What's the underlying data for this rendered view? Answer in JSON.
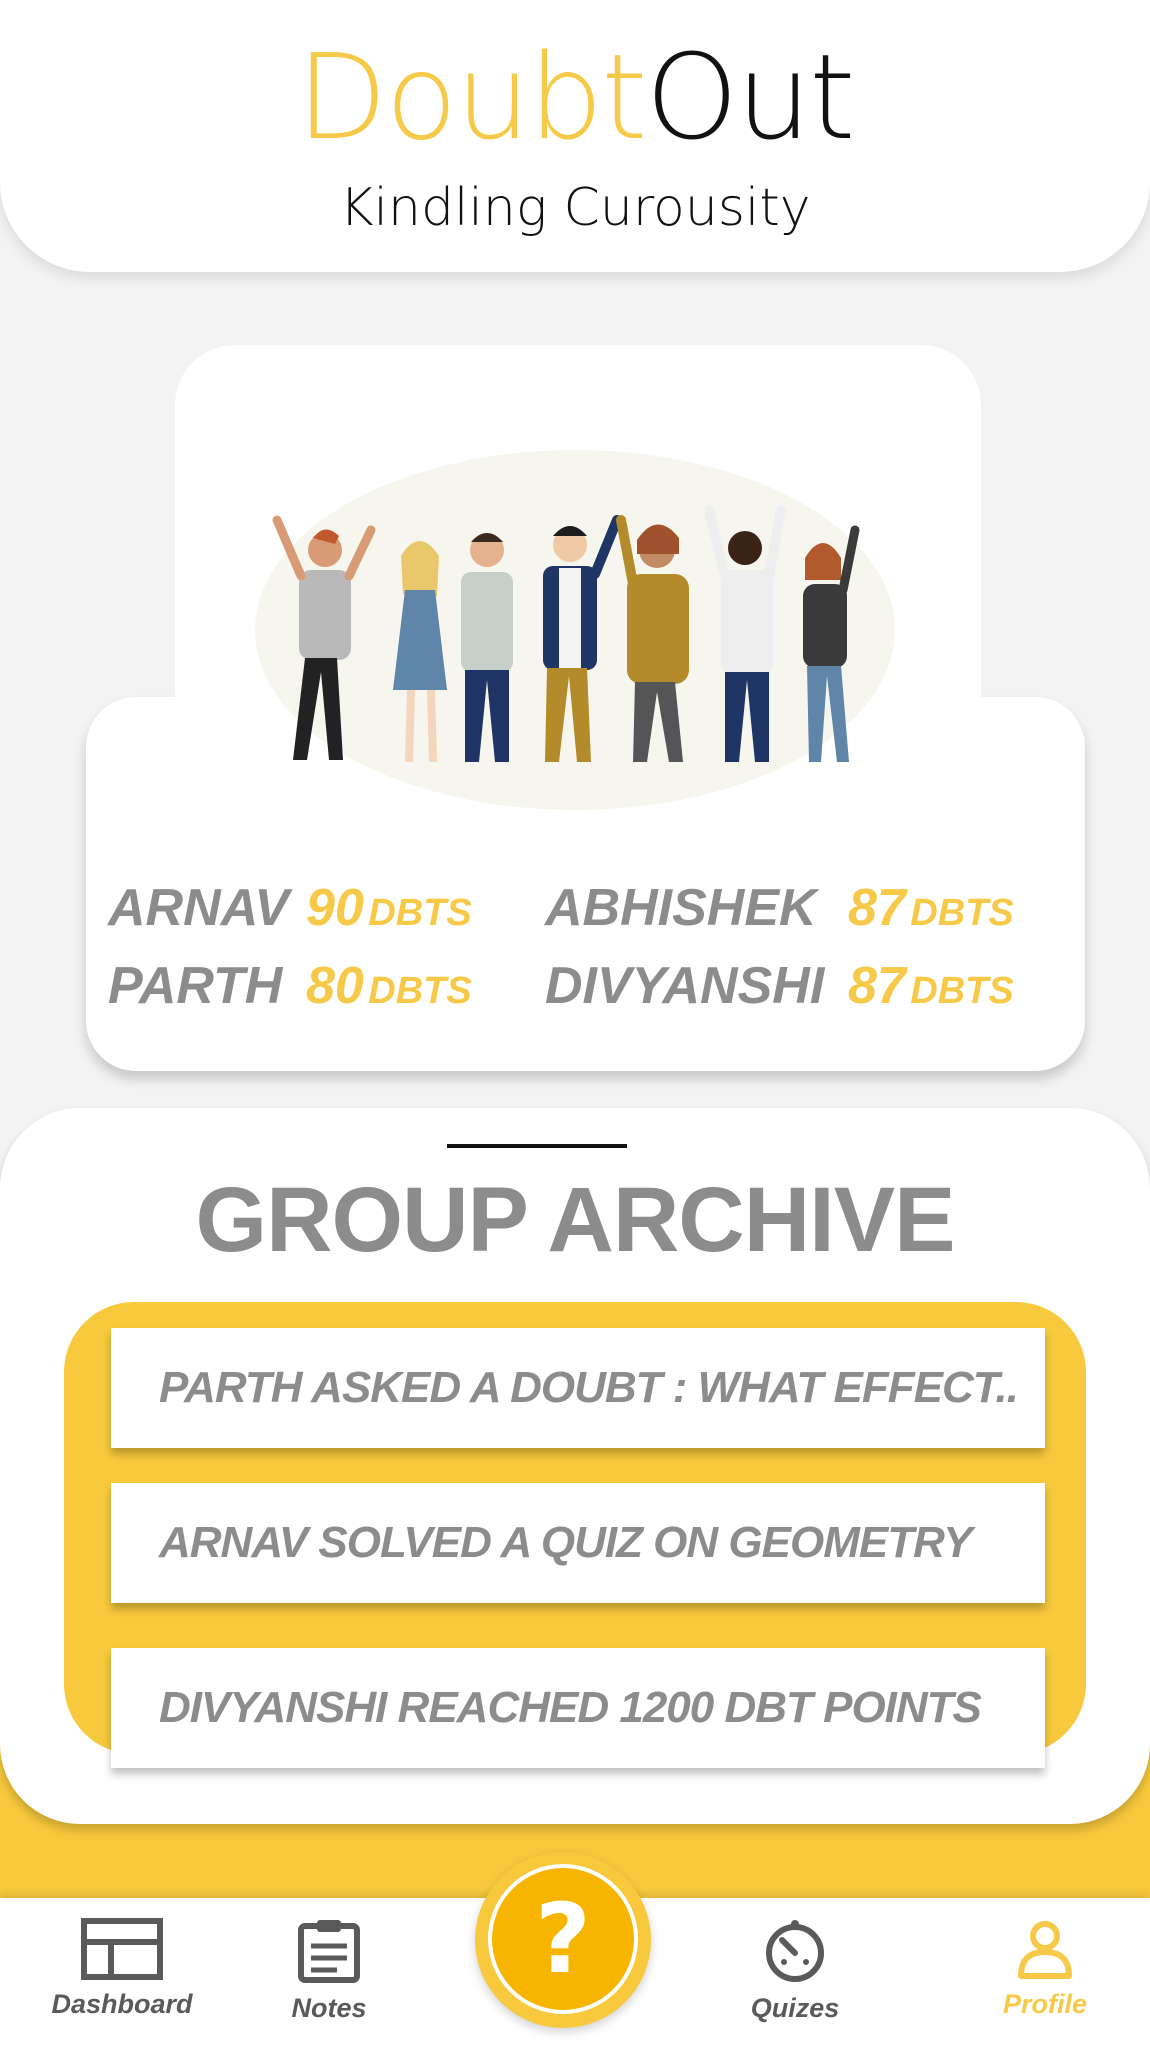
{
  "header": {
    "logo_part1": "Doubt",
    "logo_part2": "Out",
    "tagline": "Kindling Curousity"
  },
  "leaderboard": {
    "unit": "DBTS",
    "entries": [
      {
        "name": "ARNAV",
        "score": "90"
      },
      {
        "name": "ABHISHEK",
        "score": "87"
      },
      {
        "name": "PARTH",
        "score": "80"
      },
      {
        "name": "DIVYANSHI",
        "score": "87"
      }
    ]
  },
  "archive": {
    "title": "GROUP ARCHIVE",
    "items": [
      "PARTH ASKED A DOUBT : WHAT EFFECT..",
      "ARNAV SOLVED A QUIZ ON GEOMETRY",
      "DIVYANSHI REACHED 1200 DBT  POINTS"
    ]
  },
  "nav": {
    "dashboard": "Dashboard",
    "notes": "Notes",
    "quizes": "Quizes",
    "profile": "Profile",
    "fab": "?",
    "active": "Profile"
  },
  "icons": {
    "dashboard": "dashboard-icon",
    "notes": "clipboard-icon",
    "quizes": "timer-icon",
    "profile": "person-icon",
    "fab": "question-icon"
  },
  "colors": {
    "accent": "#f7c948",
    "fab": "#f7b500",
    "text_gray": "#8c8c8c"
  }
}
